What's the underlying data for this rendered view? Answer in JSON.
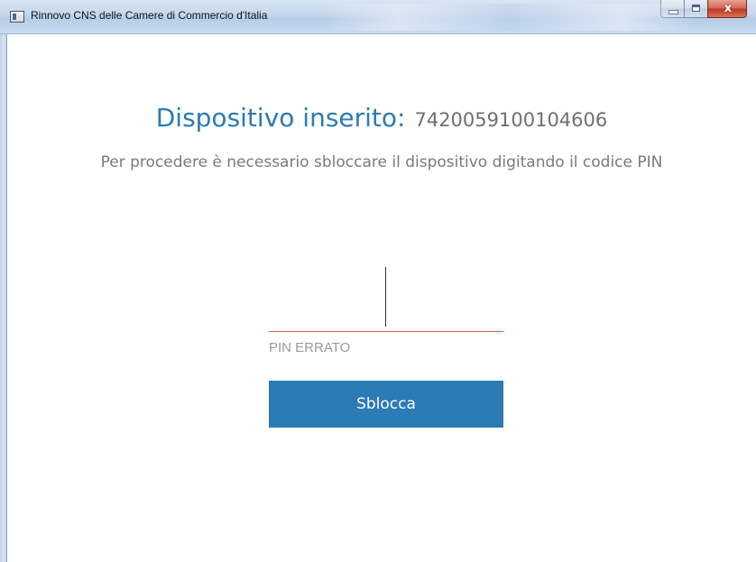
{
  "window": {
    "title": "Rinnovo CNS delle Camere di Commercio d'Italia",
    "close_glyph": "x",
    "icon": "app-window-icon"
  },
  "main": {
    "heading_label": "Dispositivo inserito:",
    "device_id": "7420059100104606",
    "instruction": "Per procedere è necessario sbloccare il dispositivo digitando il codice PIN",
    "pin": {
      "value": "",
      "placeholder": "",
      "error_text": "PIN ERRATO",
      "underline_color": "#d9534f"
    },
    "unlock_button_label": "Sblocca"
  },
  "colors": {
    "accent": "#2b7bb5",
    "text_muted": "#7a7a7a",
    "error": "#d9534f"
  }
}
